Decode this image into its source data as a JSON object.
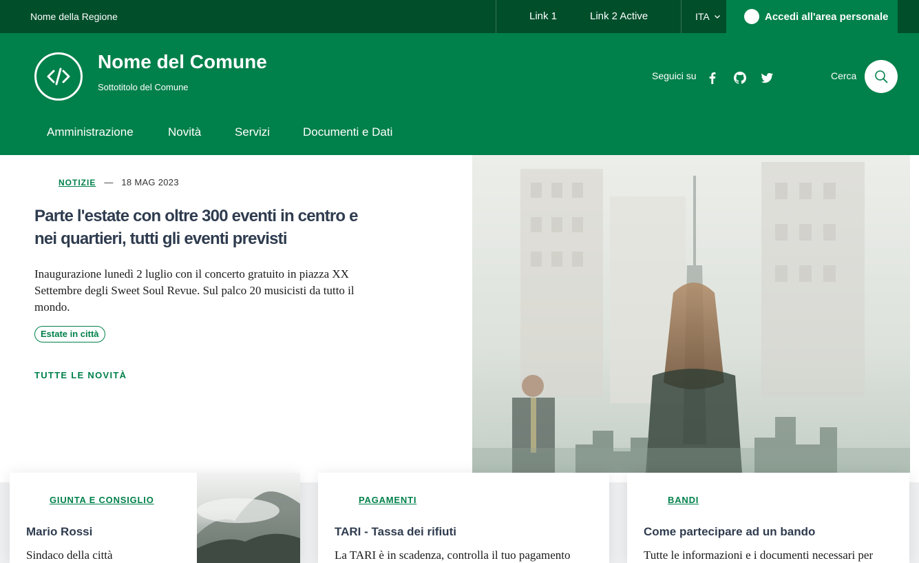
{
  "slim_header": {
    "region": "Nome della Regione",
    "links": [
      "Link 1",
      "Link 2 Active"
    ],
    "language": "ITA",
    "login_label": "Accedi all'area personale"
  },
  "center_header": {
    "title": "Nome del Comune",
    "subtitle": "Sottotitolo del Comune",
    "follow_label": "Seguici su",
    "social_icons": [
      "facebook-icon",
      "github-icon",
      "twitter-icon"
    ],
    "search_label": "Cerca"
  },
  "nav": {
    "items": [
      "Amministrazione",
      "Novità",
      "Servizi",
      "Documenti e Dati"
    ]
  },
  "hero": {
    "category": "NOTIZIE",
    "dash": "—",
    "date": "18 MAG 2023",
    "title": "Parte l'estate con oltre 300 eventi in centro e nei quartieri, tutti gli eventi previsti",
    "description": "Inaugurazione lunedì 2 luglio con il concerto gratuito in piazza XX Settembre degli Sweet Soul Revue. Sul palco 20 musicisti da tutto il mondo.",
    "tag": "Estate in città",
    "all_news": "TUTTE LE NOVITÀ"
  },
  "cards": [
    {
      "category": "GIUNTA E CONSIGLIO",
      "title": "Mario Rossi",
      "text": "Sindaco della città"
    },
    {
      "category": "PAGAMENTI",
      "title": "TARI - Tassa dei rifiuti",
      "text": "La TARI è in scadenza, controlla il tuo pagamento"
    },
    {
      "category": "BANDI",
      "title": "Come partecipare ad un bando",
      "text": "Tutte le informazioni e i documenti necessari per"
    }
  ],
  "colors": {
    "primary": "#00804a",
    "primary_dark": "#004e2a",
    "heading": "#2f3c4f"
  }
}
